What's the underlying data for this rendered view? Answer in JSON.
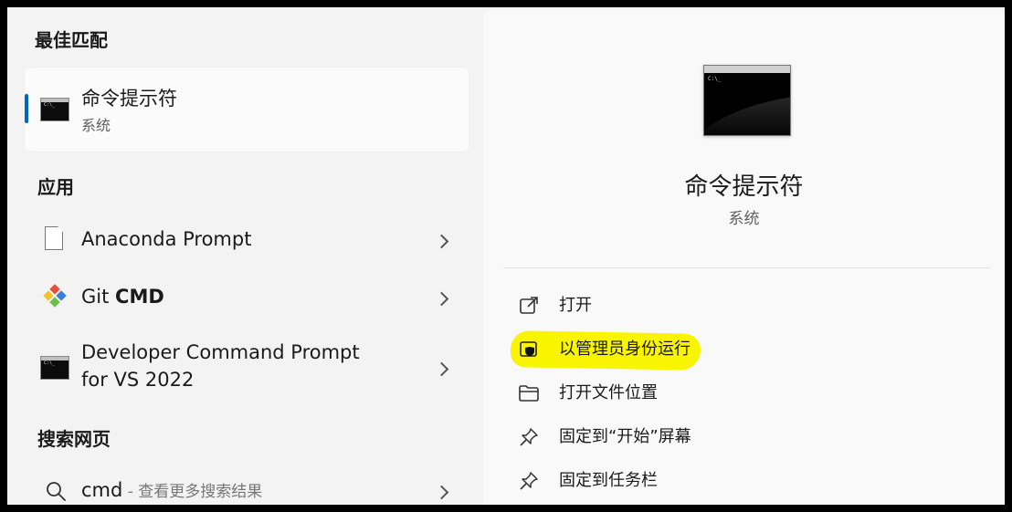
{
  "best_match": {
    "header": "最佳匹配",
    "title": "命令提示符",
    "subtitle": "系统",
    "icon": "cmd-icon"
  },
  "apps": {
    "header": "应用",
    "items": [
      {
        "label": "Anaconda Prompt",
        "icon": "document-icon"
      },
      {
        "label_prefix": "Git ",
        "label_bold": "CMD",
        "icon": "git-icon"
      },
      {
        "label_line1": "Developer Command Prompt",
        "label_line2": "for VS 2022",
        "icon": "cmd-icon"
      }
    ]
  },
  "web_search": {
    "header": "搜索网页",
    "query": "cmd",
    "suffix": " - 查看更多搜索结果",
    "icon": "search-icon"
  },
  "detail": {
    "title": "命令提示符",
    "subtitle": "系统",
    "icon_text": "C:\\_",
    "actions": [
      {
        "label": "打开",
        "icon": "open-external-icon"
      },
      {
        "label": "以管理员身份运行",
        "icon": "shield-icon",
        "highlighted": true
      },
      {
        "label": "打开文件位置",
        "icon": "folder-icon"
      },
      {
        "label": "固定到“开始”屏幕",
        "icon": "pin-icon"
      },
      {
        "label": "固定到任务栏",
        "icon": "pin-icon"
      }
    ]
  },
  "colors": {
    "accent": "#0067c0",
    "highlight": "#f9f500"
  }
}
